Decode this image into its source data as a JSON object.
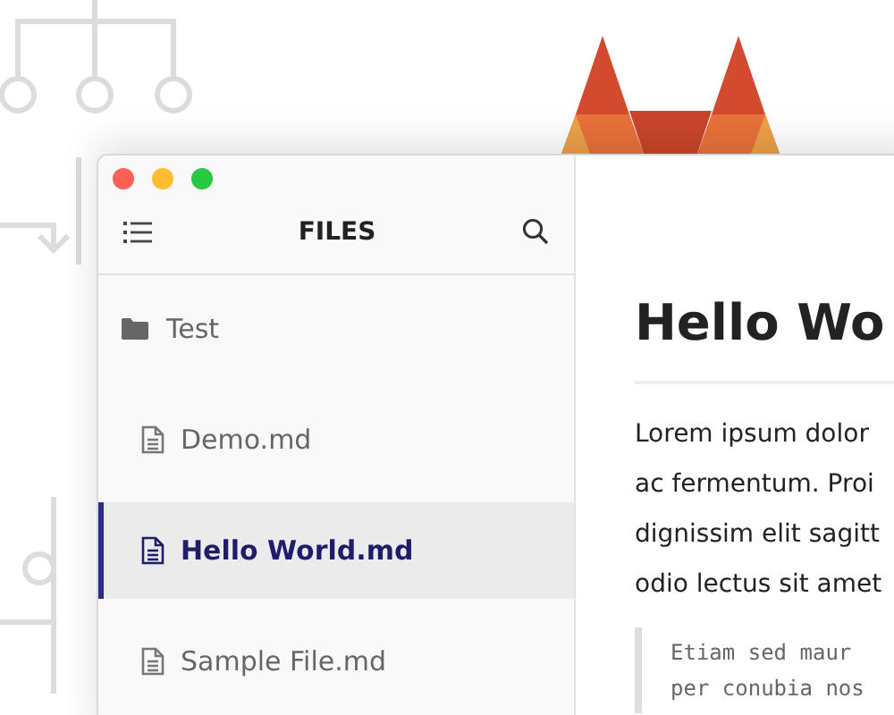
{
  "sidebar": {
    "title": "FILES",
    "tree": [
      {
        "kind": "folder",
        "label": "Test",
        "selected": false,
        "children": [
          {
            "kind": "file",
            "label": "Demo.md",
            "selected": false
          },
          {
            "kind": "file",
            "label": "Hello World.md",
            "selected": true
          },
          {
            "kind": "file",
            "label": "Sample File.md",
            "selected": false
          }
        ]
      }
    ]
  },
  "editor": {
    "heading": "Hello Wo",
    "paragraph_lines": [
      "Lorem ipsum dolor",
      "ac fermentum. Proi",
      "dignissim elit sagitt",
      "odio lectus sit amet"
    ],
    "blockquote_lines": [
      "Etiam sed maur",
      "per conubia nos"
    ]
  }
}
